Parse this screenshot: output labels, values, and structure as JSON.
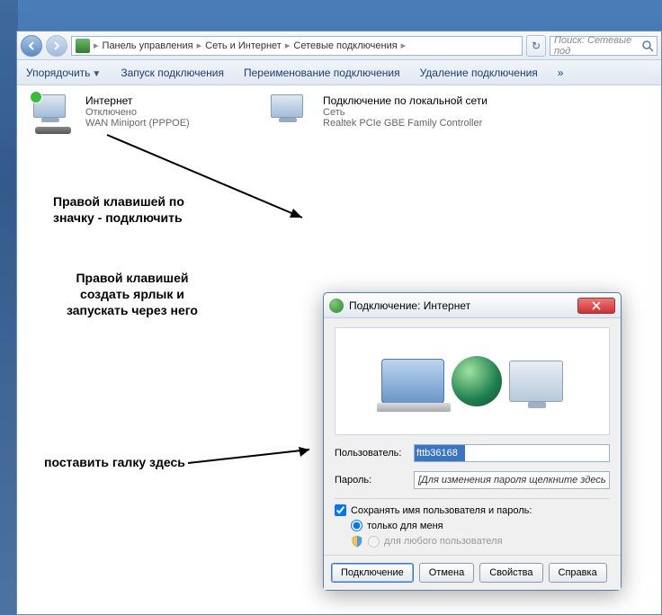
{
  "breadcrumb": {
    "seg1": "Панель управления",
    "seg2": "Сеть и Интернет",
    "seg3": "Сетевые подключения"
  },
  "search": {
    "placeholder": "Поиск: Сетевые под"
  },
  "toolbar": {
    "organize": "Упорядочить",
    "start": "Запуск подключения",
    "rename": "Переименование подключения",
    "delete": "Удаление подключения",
    "more": "»"
  },
  "connections": {
    "inet": {
      "title": "Интернет",
      "status": "Отключено",
      "device": "WAN Miniport (PPPOE)"
    },
    "lan": {
      "title": "Подключение по локальной сети",
      "status": "Сеть",
      "device": "Realtek PCIe GBE Family Controller"
    }
  },
  "annotations": {
    "a1_l1": "Правой клавишей по",
    "a1_l2": "значку - подключить",
    "a2_l1": "Правой клавишей",
    "a2_l2": "создать ярлык и",
    "a2_l3": "запускать через него",
    "a3": "поставить галку здесь"
  },
  "dialog": {
    "title": "Подключение: Интернет",
    "user_label": "Пользователь:",
    "user_value": "fttb36168",
    "pwd_label": "Пароль:",
    "pwd_placeholder": "[Для изменения пароля щелкните здесь]",
    "save_creds": "Сохранять имя пользователя и пароль:",
    "radio_me": "только для меня",
    "radio_all": "для любого пользователя",
    "btn_connect": "Подключение",
    "btn_cancel": "Отмена",
    "btn_props": "Свойства",
    "btn_help": "Справка"
  }
}
